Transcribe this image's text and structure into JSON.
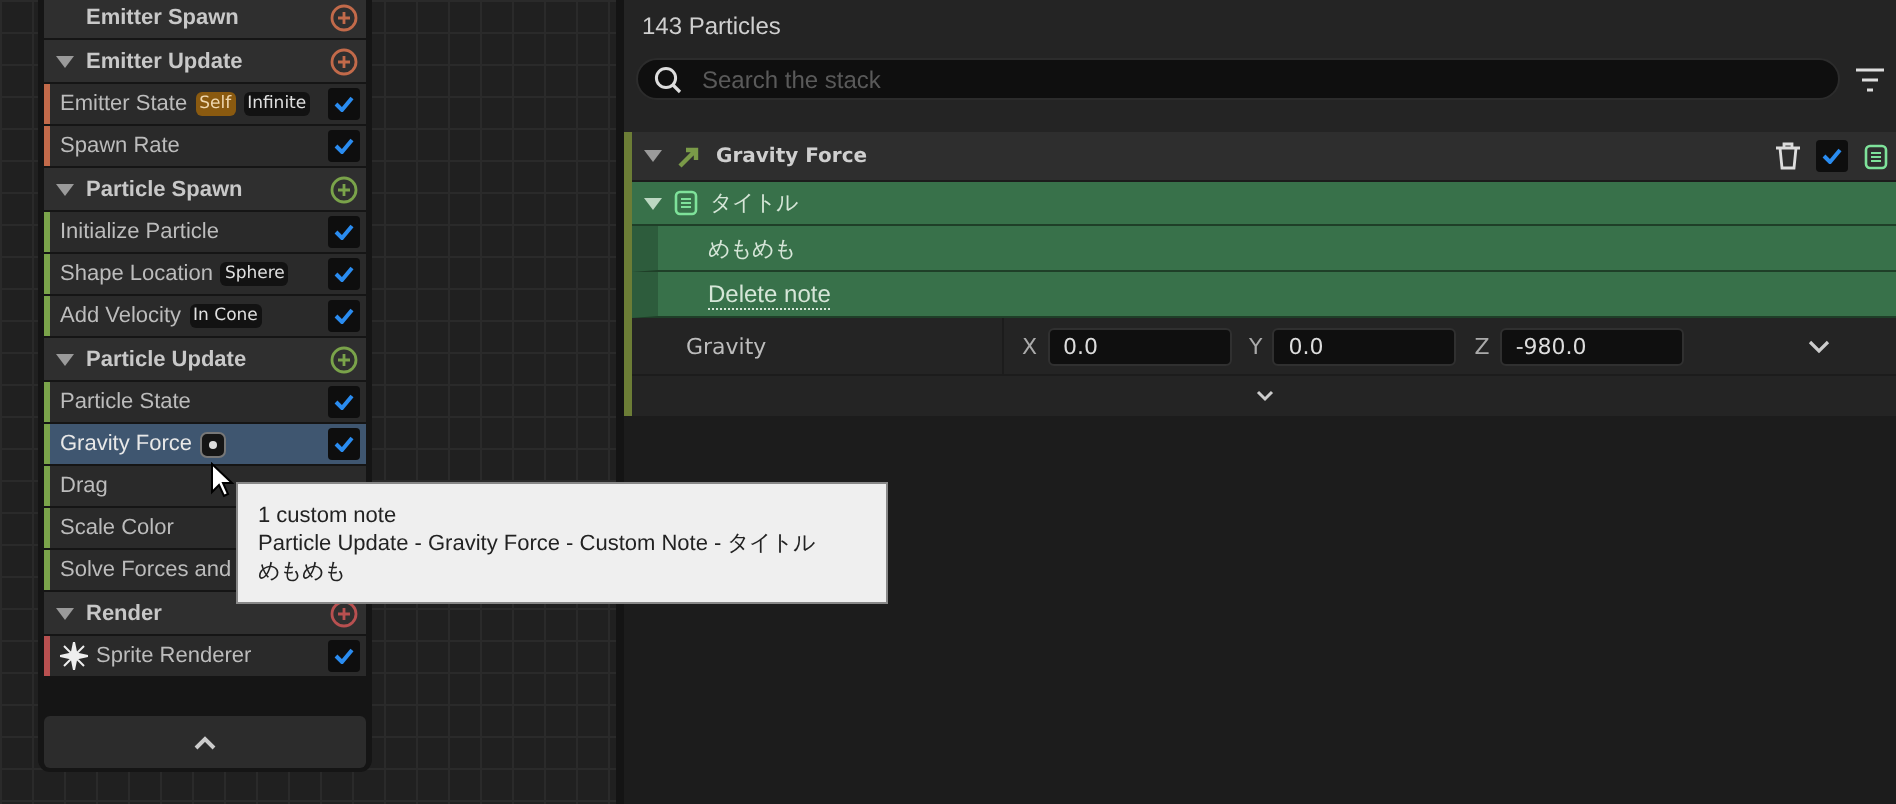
{
  "stack": {
    "sections": [
      {
        "title": "Emitter Spawn",
        "color": "#c26a4a"
      },
      {
        "title": "Emitter Update",
        "color": "#c26a4a",
        "items": [
          {
            "kind": "module",
            "label": "Emitter State",
            "tags": [
              {
                "text": "Self",
                "kind": "accent"
              },
              {
                "text": "Infinite",
                "kind": "plain"
              }
            ],
            "checked": true,
            "selected": false
          },
          {
            "kind": "module",
            "label": "Spawn Rate",
            "checked": true,
            "selected": false
          }
        ]
      },
      {
        "title": "Particle Spawn",
        "color": "#7aa34a",
        "items": [
          {
            "kind": "module",
            "label": "Initialize Particle",
            "checked": true,
            "selected": false
          },
          {
            "kind": "module",
            "label": "Shape Location",
            "tags": [
              {
                "text": "Sphere",
                "kind": "plain"
              }
            ],
            "checked": true,
            "selected": false
          },
          {
            "kind": "module",
            "label": "Add Velocity",
            "tags": [
              {
                "text": "In Cone",
                "kind": "plain"
              }
            ],
            "checked": true,
            "selected": false
          }
        ]
      },
      {
        "title": "Particle Update",
        "color": "#7aa34a",
        "items": [
          {
            "kind": "module",
            "label": "Particle State",
            "checked": true,
            "selected": false
          },
          {
            "kind": "module",
            "label": "Gravity Force",
            "note": true,
            "checked": true,
            "selected": true
          },
          {
            "kind": "module",
            "label": "Drag",
            "selected": false
          },
          {
            "kind": "module",
            "label": "Scale Color",
            "selected": false
          },
          {
            "kind": "module",
            "label": "Solve Forces and",
            "selected": false
          }
        ]
      },
      {
        "title": "Render",
        "color": "#b85050",
        "items": [
          {
            "kind": "renderer",
            "label": "Sprite Renderer",
            "checked": true,
            "selected": false
          }
        ]
      }
    ]
  },
  "tooltip": {
    "lines": [
      "1 custom note",
      "Particle Update - Gravity Force - Custom Note - タイトル",
      "めもめも"
    ]
  },
  "details": {
    "count": "143 Particles",
    "search": {
      "placeholder": "Search the stack"
    },
    "module": {
      "title": "Gravity Force",
      "enabled": true
    },
    "note": {
      "title": "タイトル",
      "body": "めもめも",
      "delete": "Delete note"
    },
    "parameter": {
      "label": "Gravity",
      "fields": [
        {
          "axis": "X",
          "value": "0.0"
        },
        {
          "axis": "Y",
          "value": "0.0"
        },
        {
          "axis": "Z",
          "value": "-980.0"
        }
      ]
    }
  }
}
